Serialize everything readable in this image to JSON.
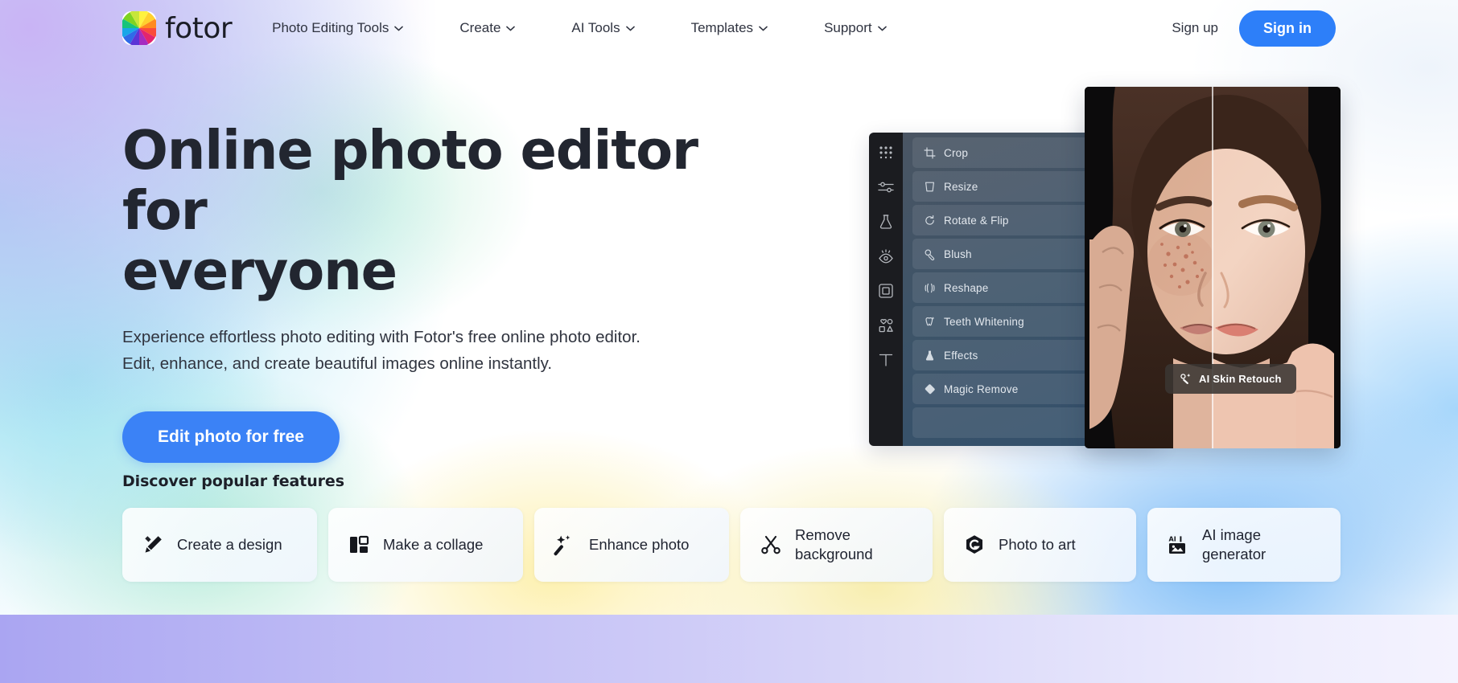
{
  "header": {
    "brand_name": "fotor",
    "logo_icon": "fotor-color-wheel-logo",
    "nav_items": [
      {
        "label": "Photo Editing Tools",
        "has_caret": true
      },
      {
        "label": "Create",
        "has_caret": true
      },
      {
        "label": "AI Tools",
        "has_caret": true
      },
      {
        "label": "Templates",
        "has_caret": true
      },
      {
        "label": "Support",
        "has_caret": true
      }
    ],
    "signup_label": "Sign up",
    "signin_label": "Sign in",
    "signin_color": "#2d7ff9"
  },
  "hero": {
    "title_line1": "Online photo editor for",
    "title_line2": "everyone",
    "subtitle_line1": "Experience effortless photo editing with Fotor's free online photo editor.",
    "subtitle_line2": "Edit, enhance, and create beautiful images online instantly.",
    "cta_label": "Edit photo for free",
    "cta_color": "#3b82f6"
  },
  "editor_mock": {
    "rail_icons": [
      "grid-dots-icon",
      "adjust-sliders-icon",
      "beauty-flask-icon",
      "eye-retouch-icon",
      "frame-square-icon",
      "shapes-sticker-icon",
      "text-tool-icon"
    ],
    "tools": [
      {
        "label": "Crop",
        "icon": "crop-icon"
      },
      {
        "label": "Resize",
        "icon": "resize-icon"
      },
      {
        "label": "Rotate & Flip",
        "icon": "rotate-icon"
      },
      {
        "label": "Blush",
        "icon": "blush-icon"
      },
      {
        "label": "Reshape",
        "icon": "reshape-icon"
      },
      {
        "label": "Teeth Whitening",
        "icon": "teeth-icon"
      },
      {
        "label": "Effects",
        "icon": "effects-icon"
      },
      {
        "label": "Magic Remove",
        "icon": "magic-eraser-icon"
      }
    ],
    "retouch_chip_label": "AI Skin Retouch",
    "retouch_chip_icon": "ai-sparkle-wand-icon"
  },
  "features": {
    "section_title": "Discover popular features",
    "cards": [
      {
        "label": "Create a design",
        "icon": "pencil-cross-icon",
        "two_line": false
      },
      {
        "label": "Make a collage",
        "icon": "collage-grid-icon",
        "two_line": false
      },
      {
        "label": "Enhance photo",
        "icon": "magic-wand-icon",
        "two_line": false
      },
      {
        "label": "Remove background",
        "icon": "scissors-icon",
        "two_line": true
      },
      {
        "label": "Photo to art",
        "icon": "hexagon-g-icon",
        "two_line": false
      },
      {
        "label": "AI image generator",
        "icon": "ai-image-icon",
        "two_line": true
      }
    ]
  },
  "colors": {
    "accent_blue": "#2d7ff9",
    "cta_blue": "#3b82f6",
    "text_dark": "#222630",
    "bottom_band_start": "#aaa5f2",
    "bottom_band_end": "#f4f3fe"
  }
}
